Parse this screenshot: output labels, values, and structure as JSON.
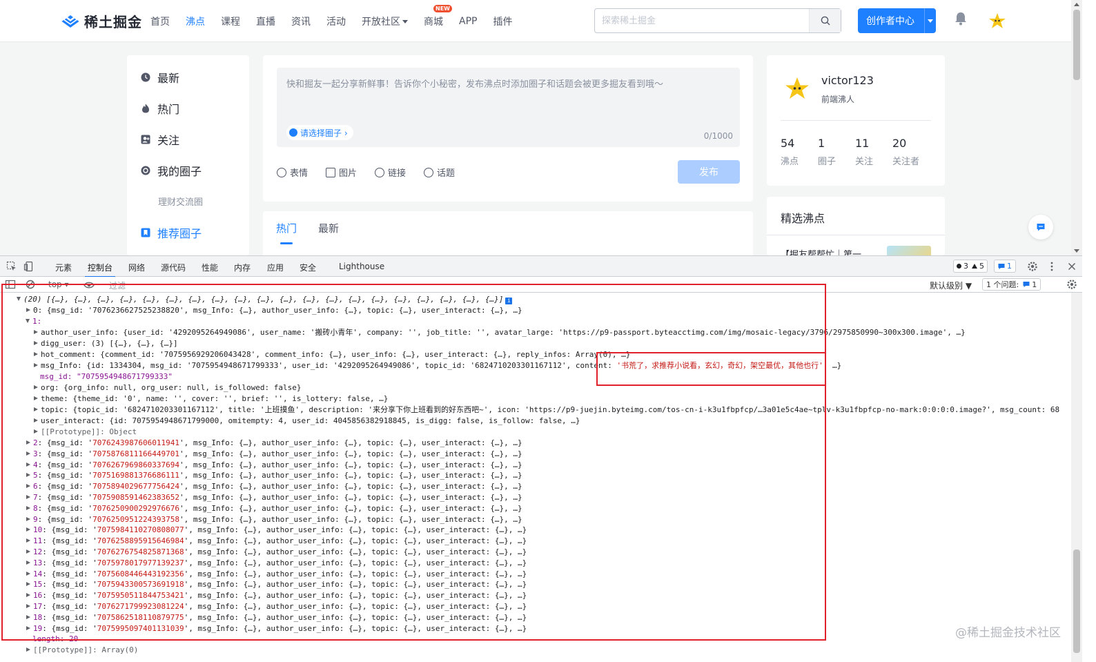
{
  "header": {
    "logo_text": "稀土掘金",
    "nav": [
      {
        "label": "首页"
      },
      {
        "label": "沸点"
      },
      {
        "label": "课程"
      },
      {
        "label": "直播"
      },
      {
        "label": "资讯"
      },
      {
        "label": "活动"
      },
      {
        "label": "开放社区"
      },
      {
        "label": "商城",
        "badge": "NEW"
      },
      {
        "label": "APP"
      },
      {
        "label": "插件"
      }
    ],
    "active_nav": "沸点",
    "search_placeholder": "探索稀土掘金",
    "creator_button": "创作者中心"
  },
  "left_sidebar": {
    "items": [
      {
        "label": "最新",
        "icon": "clock-icon"
      },
      {
        "label": "热门",
        "icon": "flame-icon"
      },
      {
        "label": "关注",
        "icon": "follow-icon"
      },
      {
        "label": "我的圈子",
        "icon": "circle-icon"
      }
    ],
    "sub_item": "理财交流圈",
    "recommend": {
      "label": "推荐圈子",
      "icon": "bookmark-icon"
    }
  },
  "editor": {
    "placeholder": "快和掘友一起分享新鲜事！告诉你个小秘密，发布沸点时添加圈子和话题会被更多掘友看到哦～",
    "circle_chip": "请选择圈子 ›",
    "char_count": "0/1000",
    "tools": [
      {
        "label": "表情",
        "icon": "emoji-icon"
      },
      {
        "label": "图片",
        "icon": "image-icon"
      },
      {
        "label": "链接",
        "icon": "link-icon"
      },
      {
        "label": "话题",
        "icon": "topic-icon"
      }
    ],
    "publish": "发布"
  },
  "feed_tabs": [
    {
      "label": "热门"
    },
    {
      "label": "最新"
    }
  ],
  "profile": {
    "name": "victor123",
    "title": "前端沸人",
    "stats": [
      {
        "num": "54",
        "label": "沸点"
      },
      {
        "num": "1",
        "label": "圈子"
      },
      {
        "num": "11",
        "label": "关注"
      },
      {
        "num": "20",
        "label": "关注者"
      }
    ]
  },
  "featured": {
    "title": "精选沸点",
    "first_item": "【掘友帮帮忙｜第一"
  },
  "devtools": {
    "tabs": [
      "元素",
      "控制台",
      "网络",
      "源代码",
      "性能",
      "内存",
      "应用",
      "安全",
      "Lighthouse"
    ],
    "active_tab": "控制台",
    "error_count": "3",
    "warn_count": "5",
    "issue_count": "1",
    "context": "top ▾",
    "filter_placeholder": "过滤",
    "level": "默认级别 ▼",
    "issues_label": "1 个问题:",
    "issues_num": "1"
  },
  "console": {
    "array_header": "(20) [{…}, {…}, {…}, {…}, {…}, {…}, {…}, {…}, {…}, {…}, {…}, {…}, {…}, {…}, {…}, {…}, {…}, {…}, {…}, {…}]",
    "item0": "0: {msg_id: '7076236627525238820', msg_Info: {…}, author_user_info: {…}, topic: {…}, user_interact: {…}, …}",
    "item1_label": "1:",
    "author_user_info": "author_user_info: {user_id: '4292095264949086', user_name: '搬砖小青年', company: '', job_title: '', avatar_large: 'https://p9-passport.byteacctimg.com/img/mosaic-legacy/3796/2975850990~300x300.image', …}",
    "digg_user": "digg_user: (3) [{…}, {…}, {…}]",
    "hot_comment": "hot_comment: {comment_id: '7075956929206043428', comment_info: {…}, user_info: {…}, user_interact: {…}, reply_infos: Array(0), …}",
    "msg_info_prefix": "msg_Info: {id: 1334304, msg_id: '7075954948671799333', user_id: '4292095264949086', topic_id: '6824710203301167112', content: ",
    "msg_info_content": "'书荒了，求推荐小说看，玄幻，奇幻，架空最优，其他也行'",
    "msg_info_suffix": ", …}",
    "msg_id": "msg_id: \"7075954948671799333\"",
    "org": "org: {org_info: null, org_user: null, is_followed: false}",
    "theme": "theme: {theme_id: '0', name: '', cover: '', brief: '', is_lottery: false, …}",
    "topic": "topic: {topic_id: '6824710203301167112', title: '上班摸鱼', description: '来分享下你上班看到的好东西吧~', icon: 'https://p9-juejin.byteimg.com/tos-cn-i-k3u1fbpfcp/…3a01e5c4ae~tplv-k3u1fbpfcp-no-mark:0:0:0:0.image?', msg_count: 68",
    "user_interact": "user_interact: {id: 7075954948671799000, omitempty: 4, user_id: 4045856382918845, is_digg: false, is_follow: false, …}",
    "prototype_object": "[[Prototype]]: Object",
    "items": [
      {
        "idx": "2",
        "id": "7076243987606011941"
      },
      {
        "idx": "3",
        "id": "7075876811166449701"
      },
      {
        "idx": "4",
        "id": "7076267969860337694"
      },
      {
        "idx": "5",
        "id": "7075169881376686111"
      },
      {
        "idx": "6",
        "id": "7075894029677756424"
      },
      {
        "idx": "7",
        "id": "7075908591462383652"
      },
      {
        "idx": "8",
        "id": "7076250900292976676"
      },
      {
        "idx": "9",
        "id": "7076250951224393758"
      },
      {
        "idx": "10",
        "id": "7075984110270808077"
      },
      {
        "idx": "11",
        "id": "7076258895915646984"
      },
      {
        "idx": "12",
        "id": "7076276754825871368"
      },
      {
        "idx": "13",
        "id": "7075978017977139237"
      },
      {
        "idx": "14",
        "id": "7075608446443192356"
      },
      {
        "idx": "15",
        "id": "7075943300573691918"
      },
      {
        "idx": "16",
        "id": "7075950511844753421"
      },
      {
        "idx": "17",
        "id": "7076271799923081224"
      },
      {
        "idx": "18",
        "id": "7075862518110879775"
      },
      {
        "idx": "19",
        "id": "7075995097401131039"
      }
    ],
    "item_suffix": ", msg_Info: {…}, author_user_info: {…}, topic: {…}, user_interact: {…}, …}",
    "length": "length: 20",
    "prototype_array": "[[Prototype]]: Array(0)"
  },
  "watermark": "@稀土掘金技术社区",
  "colors": {
    "brand": "#1e80ff",
    "annotation": "#e0202a"
  }
}
